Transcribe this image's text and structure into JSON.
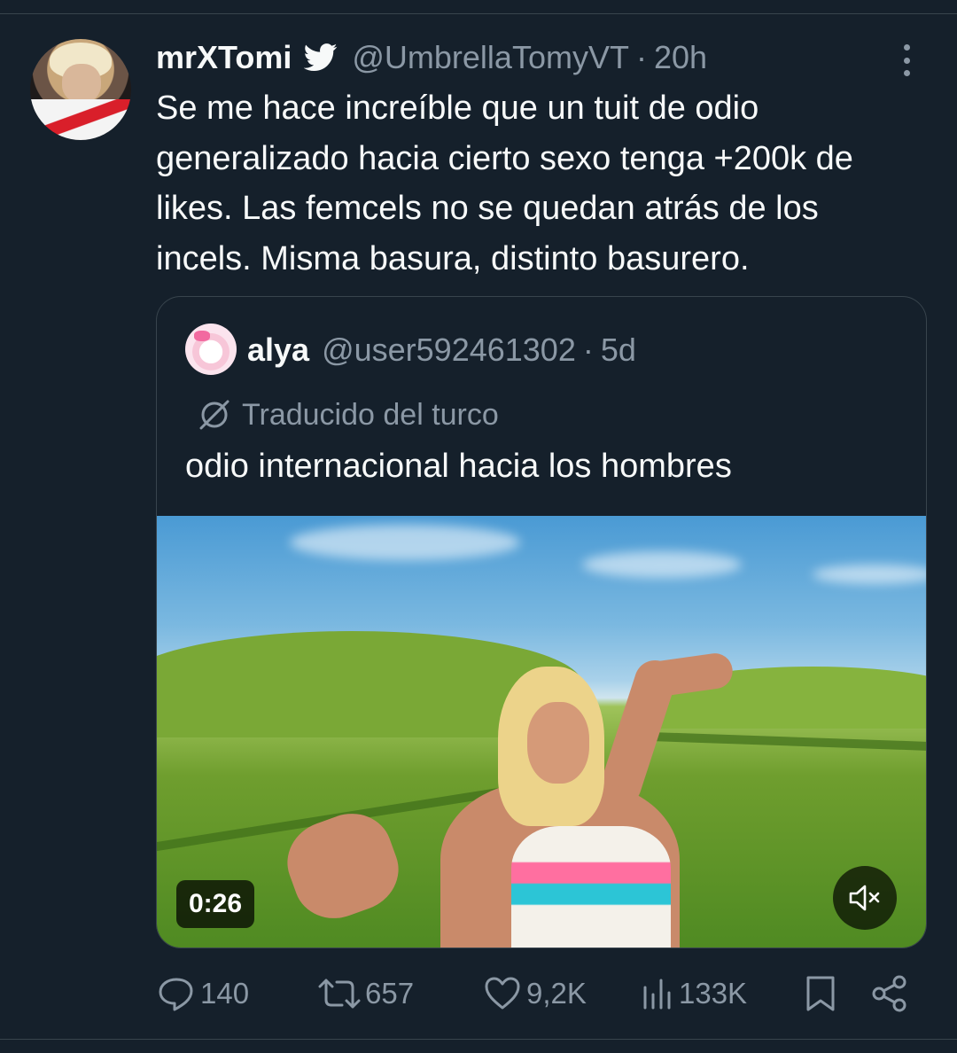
{
  "tweet": {
    "author_name": "mrXTomi",
    "author_handle": "@UmbrellaTomyVT",
    "separator": "·",
    "time": "20h",
    "text": "Se me hace increíble que un tuit de odio generalizado hacia cierto sexo tenga +200k de likes. Las femcels no se quedan atrás de los incels. Misma basura, distinto basurero.",
    "verified_badge_icon": "twitter-bird-icon"
  },
  "quote": {
    "author_name": "alya",
    "author_handle": "@user592461302",
    "separator": "·",
    "time": "5d",
    "translated_label": "Traducido del turco",
    "text": "odio internacional hacia los hombres",
    "video": {
      "duration": "0:26",
      "muted": true
    }
  },
  "actions": {
    "replies": "140",
    "retweets": "657",
    "likes": "9,2K",
    "views": "133K"
  },
  "colors": {
    "background": "#15202b",
    "border": "#38444d",
    "secondary_text": "#8b98a5",
    "primary_text": "#f7f9f9"
  }
}
